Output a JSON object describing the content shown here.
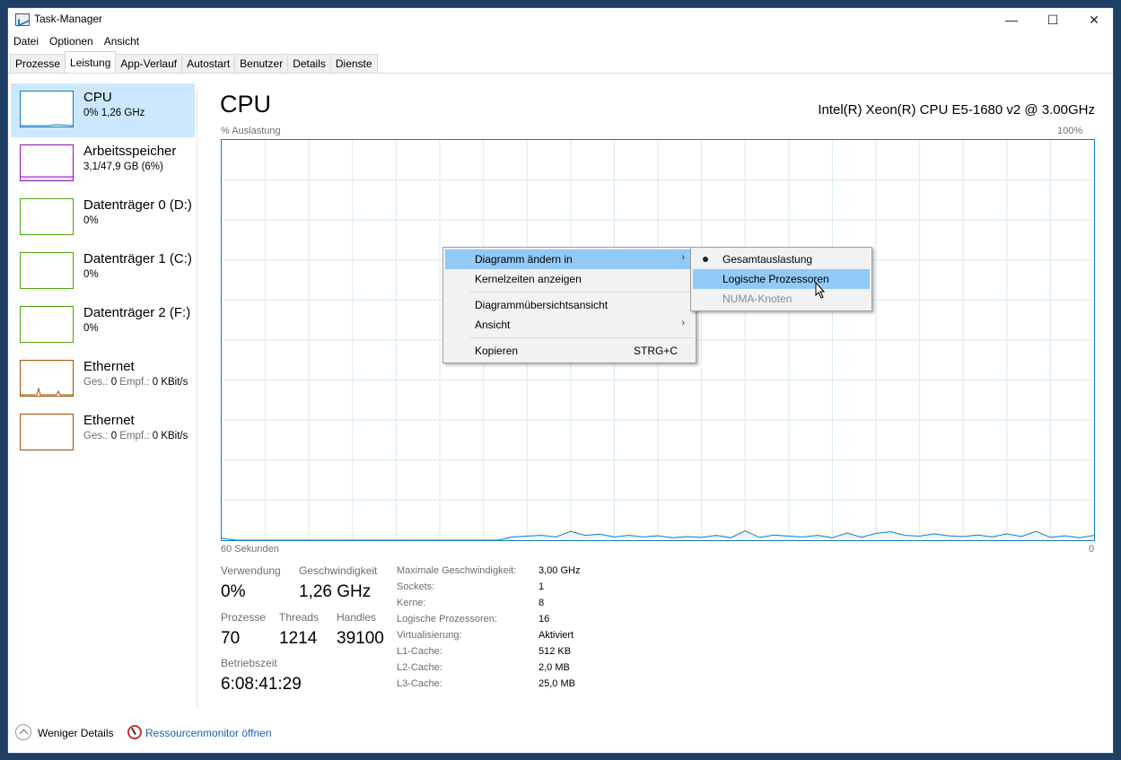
{
  "window": {
    "title": "Task-Manager",
    "minimize": "—",
    "maximize": "☐",
    "close": "✕"
  },
  "menubar": [
    "Datei",
    "Optionen",
    "Ansicht"
  ],
  "tabs": [
    "Prozesse",
    "Leistung",
    "App-Verlauf",
    "Autostart",
    "Benutzer",
    "Details",
    "Dienste"
  ],
  "active_tab": "Leistung",
  "sidebar": {
    "items": [
      {
        "name": "CPU",
        "sub": "0%  1,26 GHz",
        "color": "#117dbb"
      },
      {
        "name": "Arbeitsspeicher",
        "sub": "3,1/47,9 GB (6%)",
        "color": "#8b12ae"
      },
      {
        "name": "Datenträger 0 (D:)",
        "sub": "0%",
        "color": "#4da60c"
      },
      {
        "name": "Datenträger 1 (C:)",
        "sub": "0%",
        "color": "#4da60c"
      },
      {
        "name": "Datenträger 2 (F:)",
        "sub": "0%",
        "color": "#4da60c"
      },
      {
        "name": "Ethernet",
        "sub_prefix": "Ges.:",
        "sub_val1": "0",
        "sub_mid": "Empf.:",
        "sub_val2": "0 KBit/s",
        "color": "#a74f01"
      },
      {
        "name": "Ethernet",
        "sub_prefix": "Ges.:",
        "sub_val1": "0",
        "sub_mid": "Empf.:",
        "sub_val2": "0 KBit/s",
        "color": "#a74f01"
      }
    ]
  },
  "main": {
    "title": "CPU",
    "model": "Intel(R) Xeon(R) CPU E5-1680 v2 @ 3.00GHz",
    "y_label": "% Auslastung",
    "y_max": "100%",
    "x_left": "60 Sekunden",
    "x_right": "0"
  },
  "chart_data": {
    "type": "line",
    "ylabel": "% Auslastung",
    "ylim": [
      0,
      100
    ],
    "xlim": [
      60,
      0
    ],
    "grid": true,
    "series": [
      {
        "values": [
          0.5,
          0,
          0,
          0,
          0,
          0,
          0,
          0,
          0,
          0,
          0,
          0,
          0,
          0,
          0,
          0,
          0,
          0,
          0,
          0,
          0.8,
          1,
          1.2,
          0.8,
          2.2,
          1.2,
          1.5,
          0.8,
          1.2,
          0.8,
          1.1,
          0.6,
          0.9,
          0.7,
          1.2,
          0.6,
          2.3,
          0.7,
          1.3,
          1,
          0.8,
          1.2,
          0.6,
          1.8,
          0.7,
          1.7,
          2.1,
          1.2,
          1,
          1.6,
          1.1,
          0.9,
          1.3,
          0.8,
          1.6,
          0.9,
          2.2,
          0.7,
          1.1,
          0.6,
          1.2
        ]
      }
    ]
  },
  "stats": {
    "usage_label": "Verwendung",
    "usage_value": "0%",
    "speed_label": "Geschwindigkeit",
    "speed_value": "1,26 GHz",
    "proc_label": "Prozesse",
    "proc_value": "70",
    "threads_label": "Threads",
    "threads_value": "1214",
    "handles_label": "Handles",
    "handles_value": "39100",
    "uptime_label": "Betriebszeit",
    "uptime_value": "6:08:41:29"
  },
  "specs": [
    {
      "label": "Maximale Geschwindigkeit:",
      "value": "3,00 GHz"
    },
    {
      "label": "Sockets:",
      "value": "1"
    },
    {
      "label": "Kerne:",
      "value": "8"
    },
    {
      "label": "Logische Prozessoren:",
      "value": "16"
    },
    {
      "label": "Virtualisierung:",
      "value": "Aktiviert"
    },
    {
      "label": "L1-Cache:",
      "value": "512 KB"
    },
    {
      "label": "L2-Cache:",
      "value": "2,0 MB"
    },
    {
      "label": "L3-Cache:",
      "value": "25,0 MB"
    }
  ],
  "footer": {
    "less_details": "Weniger Details",
    "resmon": "Ressourcenmonitor öffnen",
    "resmon_color": "#1a5fb4"
  },
  "context_menu": {
    "items": [
      {
        "label": "Diagramm ändern in",
        "submenu": true
      },
      {
        "label": "Kernelzeiten anzeigen"
      },
      {
        "label": "Diagrammübersichtsansicht"
      },
      {
        "label": "Ansicht",
        "submenu": true
      },
      {
        "label": "Kopieren",
        "shortcut": "STRG+C"
      }
    ],
    "arrow": "›"
  },
  "submenu": {
    "items": [
      {
        "label": "Gesamtauslastung",
        "checked": true
      },
      {
        "label": "Logische Prozessoren",
        "hover": true
      },
      {
        "label": "NUMA-Knoten",
        "disabled": true
      }
    ]
  },
  "colors": {
    "accent": "#117dbb",
    "selection": "#cce8ff",
    "menu_highlight": "#91c9f7"
  }
}
